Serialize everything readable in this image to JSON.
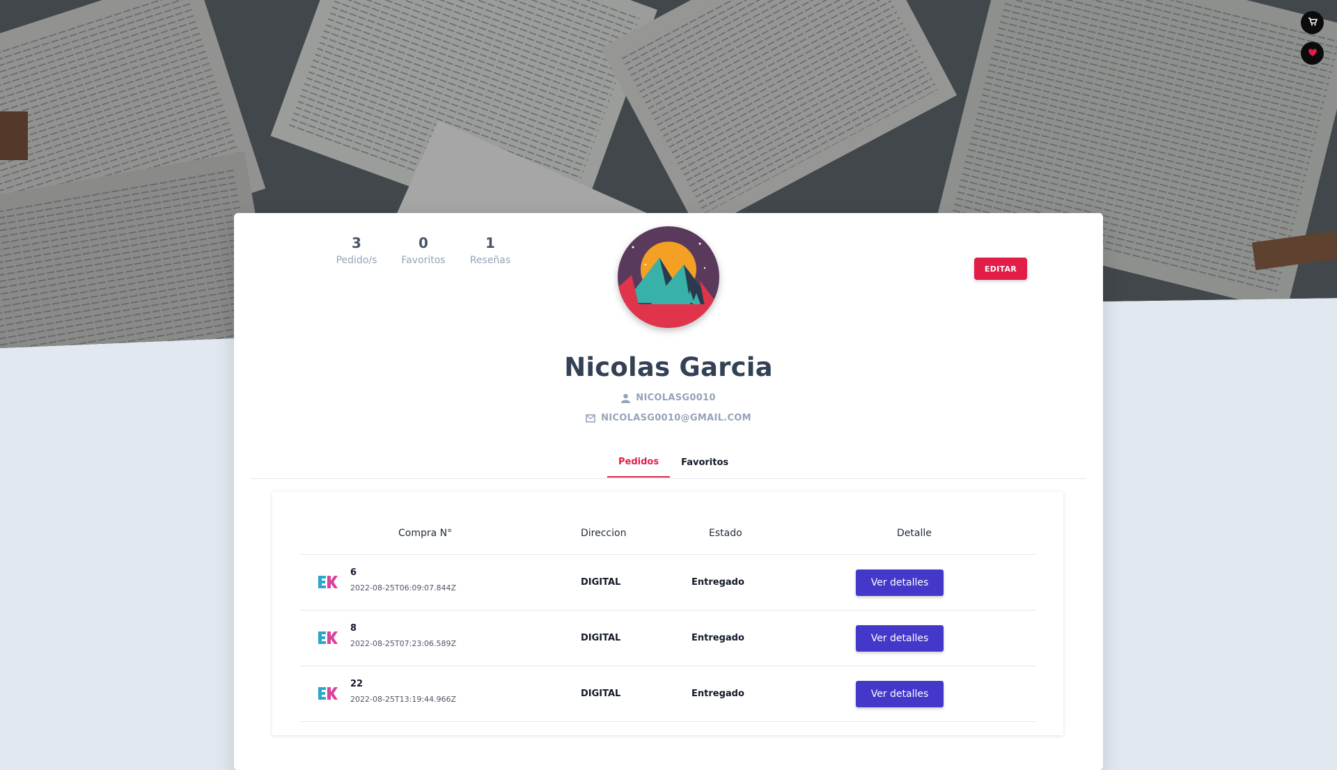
{
  "colors": {
    "accent": "#e11d48",
    "button_primary": "#4338ca",
    "page_bg": "#e2e8f0"
  },
  "floating": {
    "cart_icon": "cart-icon",
    "heart_icon": "heart-icon"
  },
  "profile": {
    "stats": [
      {
        "value": "3",
        "label": "Pedido/s"
      },
      {
        "value": "0",
        "label": "Favoritos"
      },
      {
        "value": "1",
        "label": "Reseñas"
      }
    ],
    "edit_label": "EDITAR",
    "name": "Nicolas Garcia",
    "username": "NICOLASG0010",
    "email": "NICOLASG0010@GMAIL.COM"
  },
  "tabs": [
    {
      "label": "Pedidos",
      "active": true
    },
    {
      "label": "Favoritos",
      "active": false
    }
  ],
  "orders": {
    "headers": [
      "Compra N°",
      "Direccion",
      "Estado",
      "Detalle"
    ],
    "rows": [
      {
        "id": "6",
        "date": "2022-08-25T06:09:07.844Z",
        "direccion": "DIGITAL",
        "estado": "Entregado",
        "action": "Ver detalles"
      },
      {
        "id": "8",
        "date": "2022-08-25T07:23:06.589Z",
        "direccion": "DIGITAL",
        "estado": "Entregado",
        "action": "Ver detalles"
      },
      {
        "id": "22",
        "date": "2022-08-25T13:19:44.966Z",
        "direccion": "DIGITAL",
        "estado": "Entregado",
        "action": "Ver detalles"
      }
    ]
  }
}
